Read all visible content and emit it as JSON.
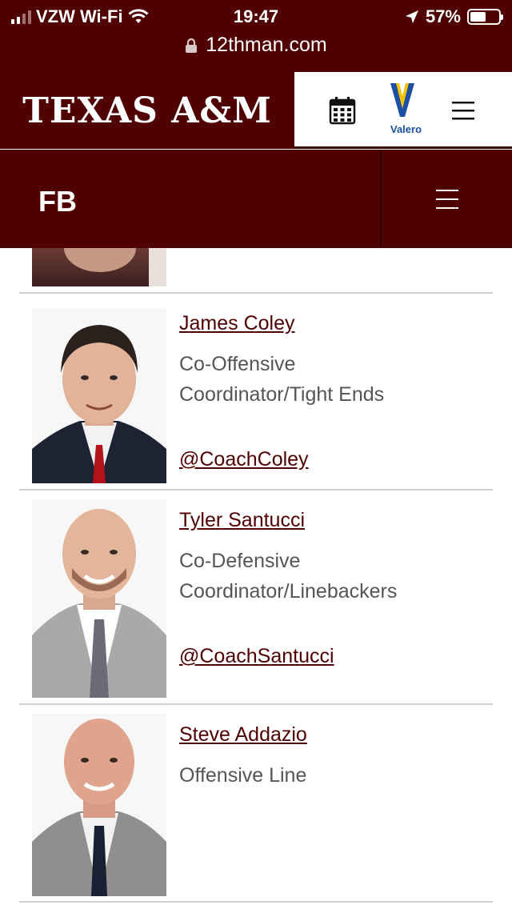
{
  "status_bar": {
    "carrier": "VZW Wi-Fi",
    "time": "19:47",
    "battery": "57%",
    "battery_level": 0.57
  },
  "browser": {
    "url": "12thman.com"
  },
  "header": {
    "brand": "TEXAS A&M",
    "sponsor": "Valero",
    "brand_color": "#500000"
  },
  "sport_nav": {
    "label": "FB"
  },
  "staff": [
    {
      "name": "James Coley",
      "title_line1": "Co-Offensive",
      "title_line2": "Coordinator/Tight Ends",
      "twitter": "@CoachColey"
    },
    {
      "name": "Tyler Santucci",
      "title_line1": "Co-Defensive",
      "title_line2": "Coordinator/Linebackers",
      "twitter": "@CoachSantucci"
    },
    {
      "name": "Steve Addazio",
      "title_line1": "Offensive Line",
      "title_line2": "",
      "twitter": ""
    }
  ]
}
